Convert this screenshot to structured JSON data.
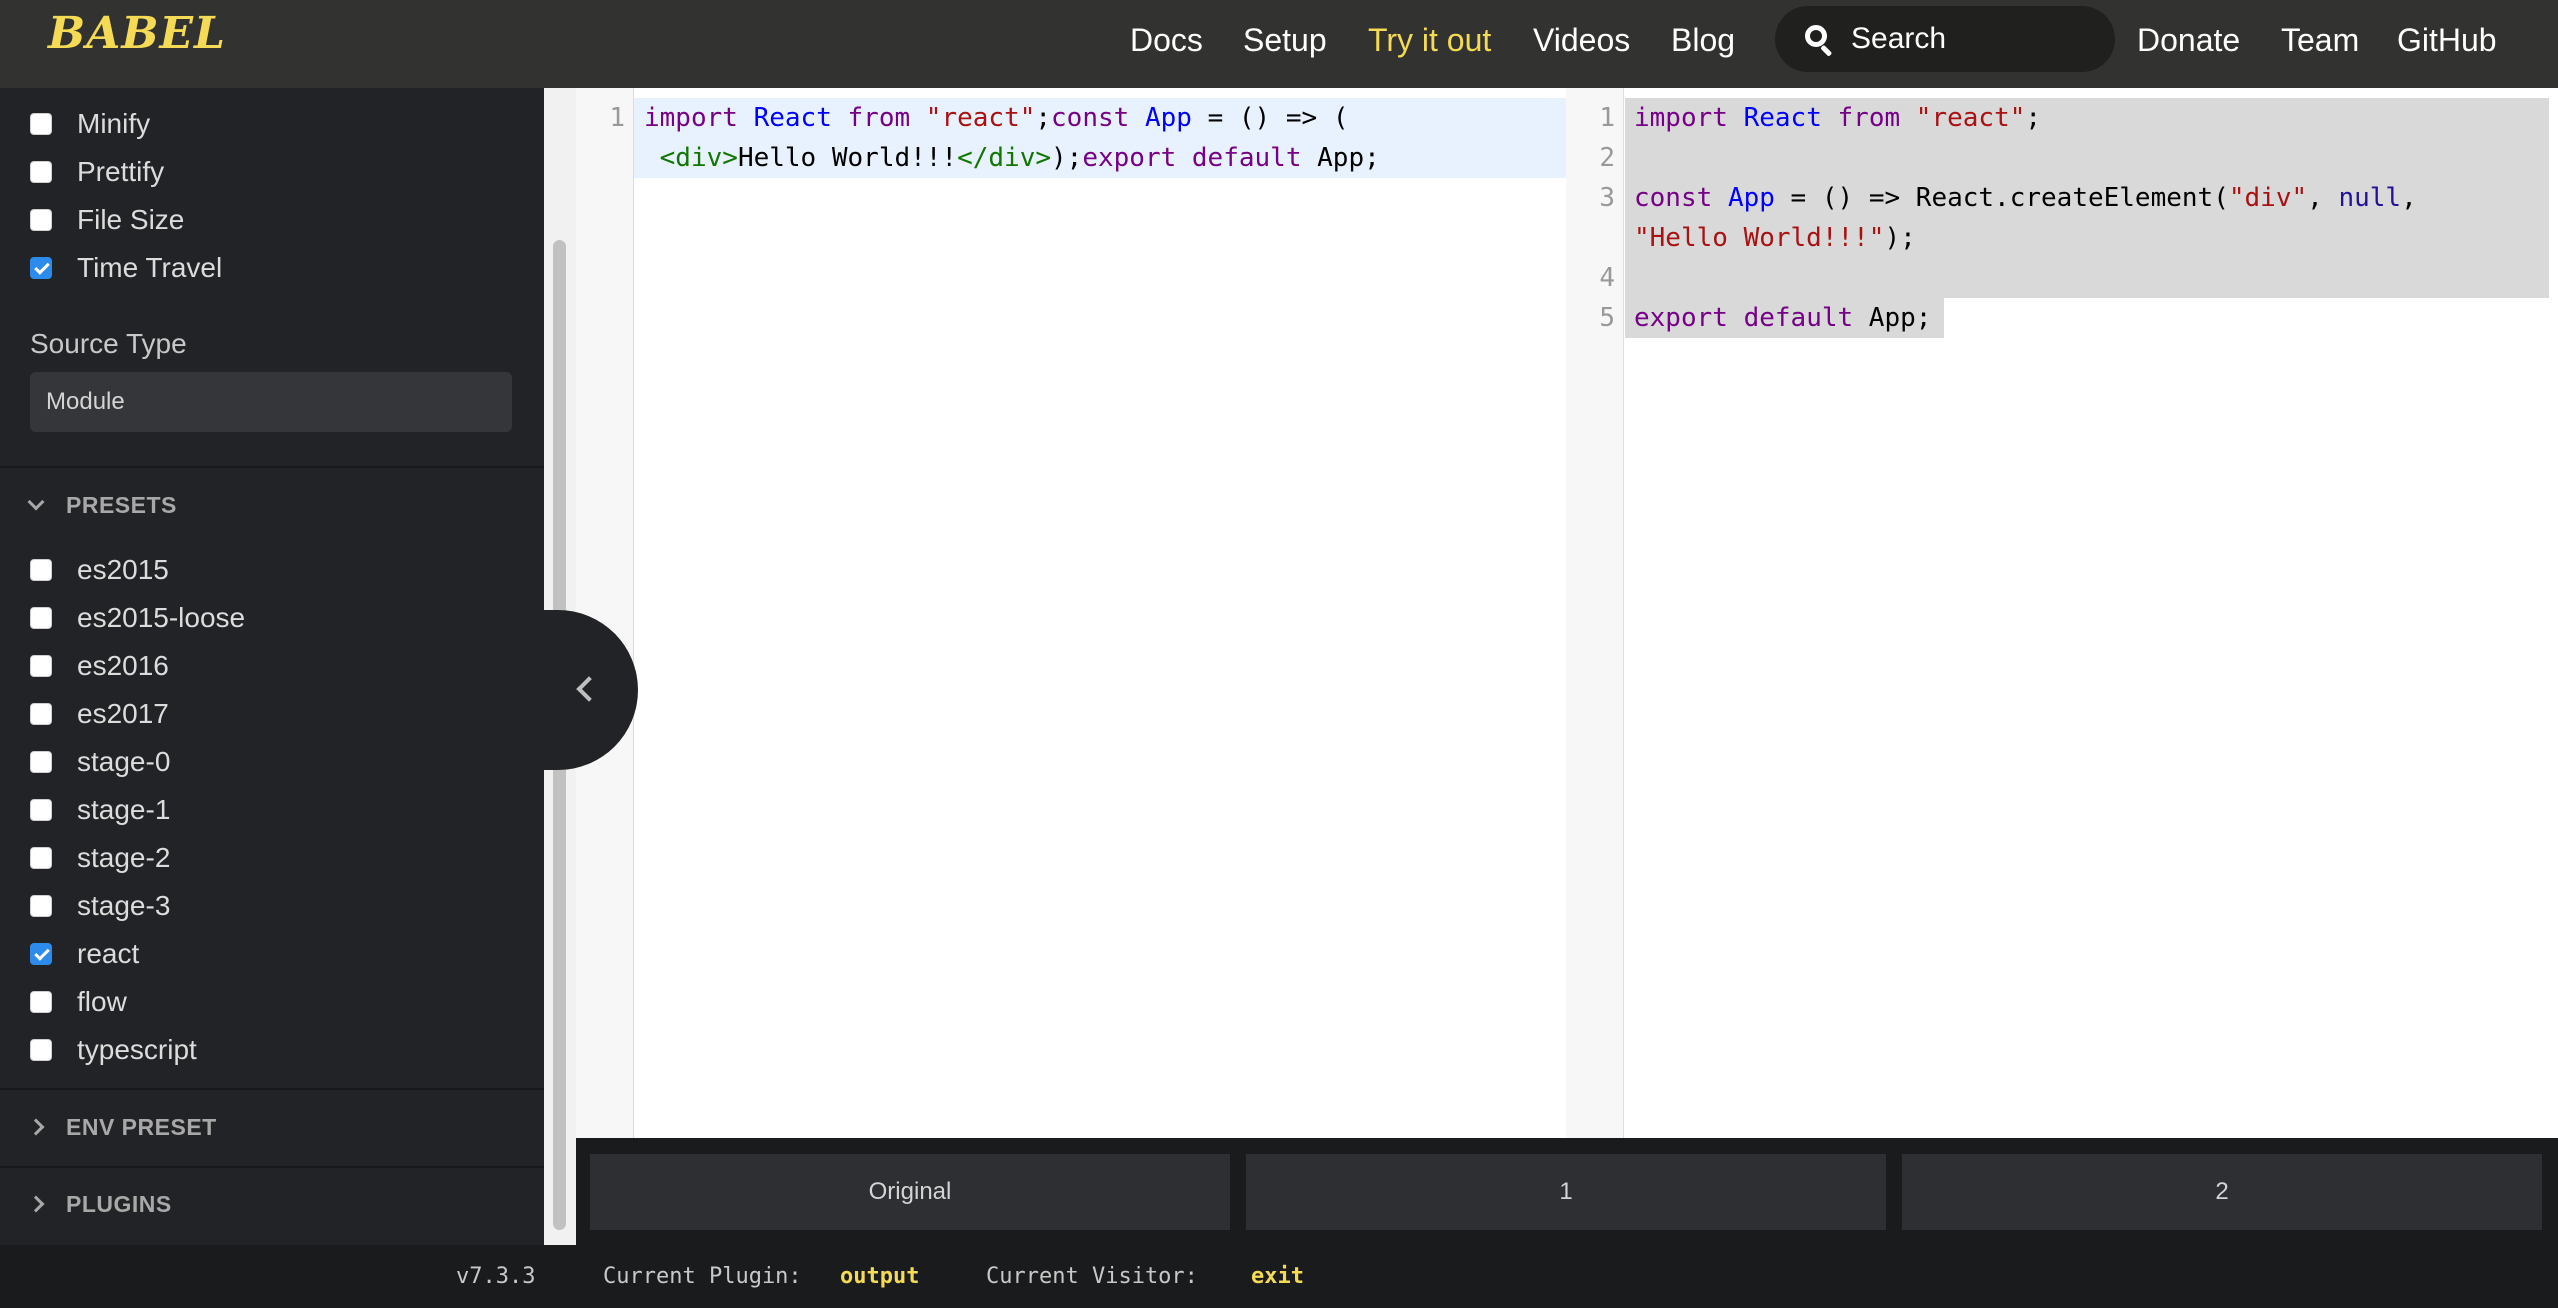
{
  "nav": {
    "logo": "BABEL",
    "items": [
      "Docs",
      "Setup",
      "Try it out",
      "Videos",
      "Blog"
    ],
    "active": "Try it out",
    "search_placeholder": "Search",
    "right_items": [
      "Donate",
      "Team",
      "GitHub"
    ]
  },
  "sidebar": {
    "options": [
      {
        "label": "Minify",
        "checked": false
      },
      {
        "label": "Prettify",
        "checked": false
      },
      {
        "label": "File Size",
        "checked": false
      },
      {
        "label": "Time Travel",
        "checked": true
      }
    ],
    "source_type_label": "Source Type",
    "source_type_value": "Module",
    "presets_label": "PRESETS",
    "presets": [
      {
        "label": "es2015",
        "checked": false
      },
      {
        "label": "es2015-loose",
        "checked": false
      },
      {
        "label": "es2016",
        "checked": false
      },
      {
        "label": "es2017",
        "checked": false
      },
      {
        "label": "stage-0",
        "checked": false
      },
      {
        "label": "stage-1",
        "checked": false
      },
      {
        "label": "stage-2",
        "checked": false
      },
      {
        "label": "stage-3",
        "checked": false
      },
      {
        "label": "react",
        "checked": true
      },
      {
        "label": "flow",
        "checked": false
      },
      {
        "label": "typescript",
        "checked": false
      }
    ],
    "env_preset_label": "ENV PRESET",
    "plugins_label": "PLUGINS"
  },
  "input_editor": {
    "line_numbers": [
      "1"
    ]
  },
  "output_editor": {
    "line_numbers": [
      "1",
      "2",
      "3",
      "4",
      "5"
    ]
  },
  "time_travel": {
    "buttons": [
      "Original",
      "1",
      "2"
    ]
  },
  "footer": {
    "version": "v7.3.3",
    "plugin_label": "Current Plugin:",
    "plugin_value": "output",
    "visitor_label": "Current Visitor:",
    "visitor_value": "exit"
  },
  "colors": {
    "nav_bg": "#323330",
    "accent_yellow": "#f5da55",
    "sidebar_bg": "#222326",
    "checkbox_checked": "#2d8ceb",
    "keyword": "#770088",
    "definition": "#0000ff",
    "string": "#aa1111",
    "tag": "#117700"
  },
  "icons": {
    "search": "search-icon",
    "collapse": "chevron-left-icon",
    "section_open": "chevron-down-icon",
    "section_closed": "chevron-right-icon"
  }
}
